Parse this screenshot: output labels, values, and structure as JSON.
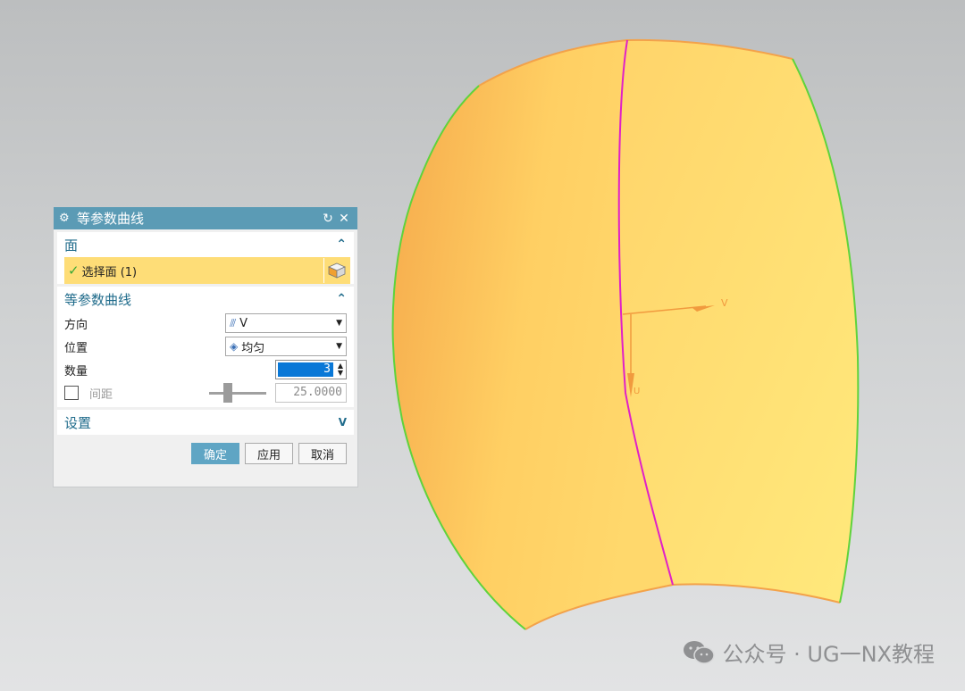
{
  "dialog": {
    "title": "等参数曲线",
    "reset_icon": "↻",
    "close_icon": "✕",
    "face_section": {
      "label": "面",
      "select_label": "选择面 (1)"
    },
    "curve_section": {
      "label": "等参数曲线",
      "direction_label": "方向",
      "direction_value": "V",
      "position_label": "位置",
      "position_value": "均匀",
      "count_label": "数量",
      "count_value": "3",
      "spacing_label": "间距",
      "spacing_value": "25.0000"
    },
    "settings_section": {
      "label": "设置"
    },
    "buttons": {
      "ok": "确定",
      "apply": "应用",
      "cancel": "取消"
    }
  },
  "viewport": {
    "axis_v_label": "V",
    "axis_u_label": "U",
    "surface_color": "#ffcf5c",
    "edge_color": "#5fd33c",
    "isocurve_color": "#e020c8"
  },
  "watermark": {
    "text": "公众号 · UG一NX教程"
  }
}
